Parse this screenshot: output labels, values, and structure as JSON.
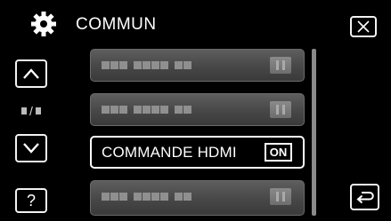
{
  "header": {
    "title": "COMMUN",
    "icon": "gear-icon"
  },
  "nav": {
    "up_icon": "chevron-up-icon",
    "down_icon": "chevron-down-icon",
    "page_indicator": "/",
    "help_label": "?",
    "close_icon": "close-icon",
    "back_icon": "return-icon"
  },
  "menu": {
    "active_item": {
      "label": "COMMANDE HDMI",
      "value": "ON"
    }
  },
  "colors": {
    "background": "#000000",
    "foreground": "#ffffff",
    "item_fill": "#4a4a4a"
  }
}
